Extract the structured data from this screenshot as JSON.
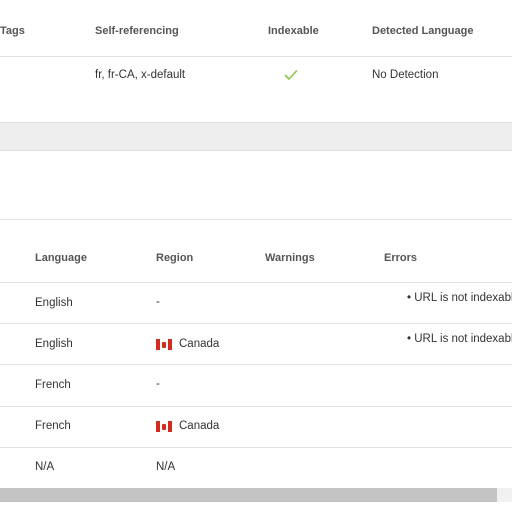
{
  "top_table": {
    "headers": {
      "tags": "Tags",
      "self_referencing": "Self-referencing",
      "indexable": "Indexable",
      "detected_language": "Detected Language"
    },
    "row": {
      "self_referencing": "fr, fr-CA, x-default",
      "indexable_icon": "checkmark-icon",
      "detected_language": "No Detection"
    }
  },
  "bottom_table": {
    "headers": {
      "language": "Language",
      "region": "Region",
      "warnings": "Warnings",
      "errors": "Errors"
    },
    "rows": [
      {
        "language": "English",
        "region": "-",
        "region_flag": "",
        "warnings": "",
        "error": "URL is not indexable"
      },
      {
        "language": "English",
        "region": "Canada",
        "region_flag": "canada-flag-icon",
        "warnings": "",
        "error": "URL is not indexable"
      },
      {
        "language": "French",
        "region": "-",
        "region_flag": "",
        "warnings": "",
        "error": ""
      },
      {
        "language": "French",
        "region": "Canada",
        "region_flag": "canada-flag-icon",
        "warnings": "",
        "error": ""
      },
      {
        "language": "N/A",
        "region": "N/A",
        "region_flag": "",
        "warnings": "",
        "error": ""
      }
    ]
  },
  "colors": {
    "check_green": "#8bc34a",
    "separator_band": "#eeeeee",
    "scrollbar_thumb": "#c4c4c4",
    "flag_red": "#d52b1e"
  }
}
